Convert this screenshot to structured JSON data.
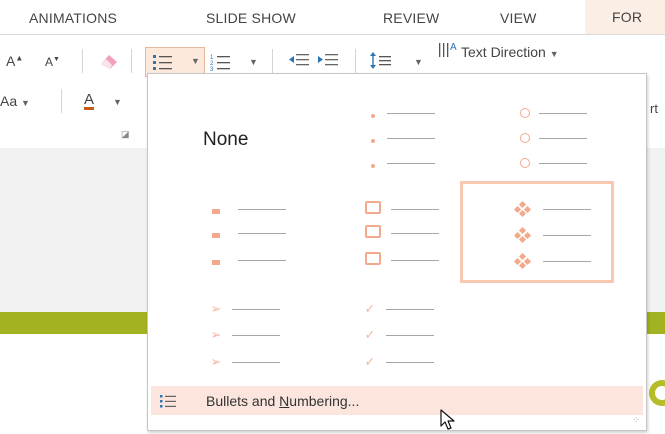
{
  "tabs": [
    {
      "label": "ANIMATIONS"
    },
    {
      "label": "SLIDE SHOW"
    },
    {
      "label": "REVIEW"
    },
    {
      "label": "VIEW"
    },
    {
      "label": "FOR"
    }
  ],
  "ribbon": {
    "text_direction_label": "Text Direction",
    "font_size_up": "A",
    "font_size_down": "A",
    "font_color_letter": "A",
    "change_case_label": "Aa",
    "cut_off_right": "rt"
  },
  "bullets_menu": {
    "none_label": "None",
    "footer_label_pre": "Bullets and ",
    "footer_label_underlined": "N",
    "footer_label_post": "umbering..."
  },
  "colors": {
    "accent": "#f2a98c",
    "selected_border": "#f7c9b0",
    "footer_bg": "#fbe5dc",
    "green_bar": "#a2b221"
  },
  "icons": {
    "arrow_glyph": "➢",
    "check_glyph": "✓"
  }
}
